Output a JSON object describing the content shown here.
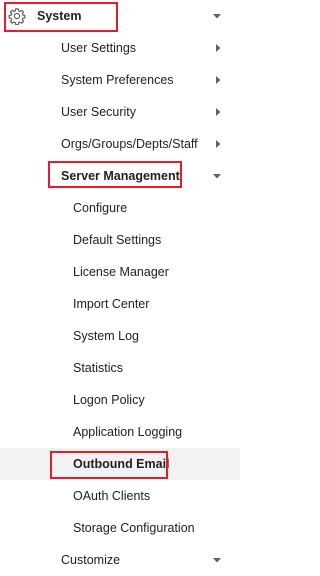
{
  "nav": {
    "system": {
      "label": "System",
      "icon": "gear-icon",
      "expanded": true
    },
    "user_settings": {
      "label": "User Settings"
    },
    "system_preferences": {
      "label": "System Preferences"
    },
    "user_security": {
      "label": "User Security"
    },
    "orgs": {
      "label": "Orgs/Groups/Depts/Staff"
    },
    "server_management": {
      "label": "Server Management",
      "expanded": true,
      "items": [
        {
          "label": "Configure"
        },
        {
          "label": "Default Settings"
        },
        {
          "label": "License Manager"
        },
        {
          "label": "Import Center"
        },
        {
          "label": "System Log"
        },
        {
          "label": "Statistics"
        },
        {
          "label": "Logon Policy"
        },
        {
          "label": "Application Logging"
        },
        {
          "label": "Outbound Email",
          "selected": true
        },
        {
          "label": "OAuth Clients"
        },
        {
          "label": "Storage Configuration"
        }
      ]
    },
    "customize": {
      "label": "Customize"
    }
  },
  "colors": {
    "highlight_border": "#e01e2d",
    "selected_background": "#f2f2f2",
    "text": "#212121",
    "icon": "#616161"
  }
}
